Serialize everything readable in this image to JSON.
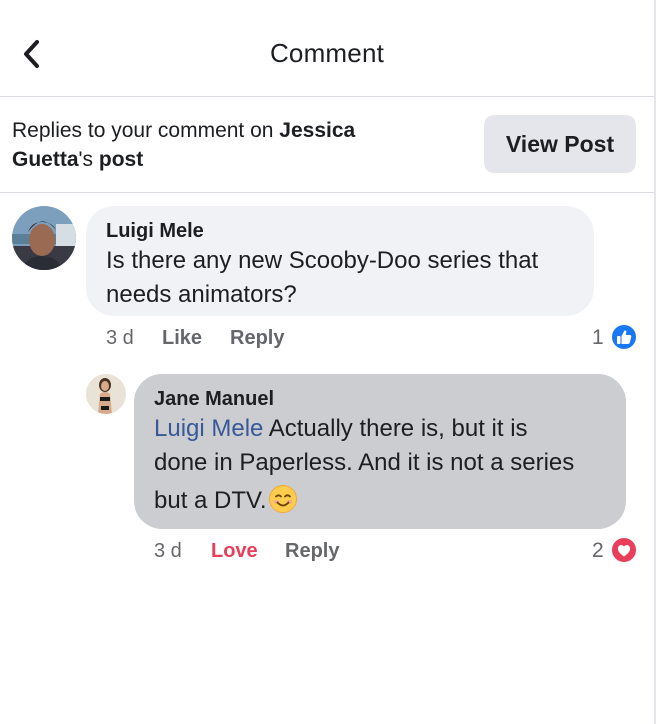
{
  "header": {
    "title": "Comment"
  },
  "subheader": {
    "prefix": "Replies to your comment on ",
    "post_owner_first": "Jessica",
    "post_owner_last": "Guetta",
    "suffix_possessive": "'s",
    "suffix_post": " post",
    "view_post_label": "View Post"
  },
  "comment": {
    "author": "Luigi Mele",
    "text_line1": "Is there any new Scooby-Doo series that",
    "text_line2": "needs animators?",
    "time": "3 d",
    "like_label": "Like",
    "reply_label": "Reply",
    "reaction_count": "1",
    "reaction_icon": "like-reaction-icon"
  },
  "reply": {
    "author": "Jane Manuel",
    "mention": "Luigi Mele",
    "text_line1": " Actually there is, but it is",
    "text_line2": "done in Paperless. And it is not a series",
    "text_line3": "but a DTV.",
    "emoji": "smiling-face-icon",
    "time": "3 d",
    "love_label": "Love",
    "reply_label": "Reply",
    "reaction_count": "2",
    "reaction_icon": "love-reaction-icon"
  },
  "colors": {
    "mention": "#385898",
    "love": "#e83e5c",
    "like_blue": "#1877f2",
    "bubble_comment": "#f0f2f5",
    "bubble_reply": "#cbcdd1"
  }
}
